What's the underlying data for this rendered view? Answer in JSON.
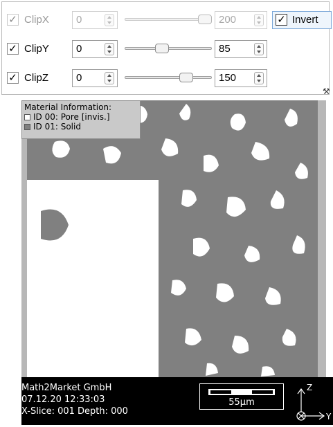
{
  "clip_rows": [
    {
      "label": "ClipX",
      "checked": true,
      "enabled": false,
      "min_value": "0",
      "max_value": "200",
      "slider_fraction": 1.0
    },
    {
      "label": "ClipY",
      "checked": true,
      "enabled": true,
      "min_value": "0",
      "max_value": "85",
      "slider_fraction": 0.43
    },
    {
      "label": "ClipZ",
      "checked": true,
      "enabled": true,
      "min_value": "0",
      "max_value": "150",
      "slider_fraction": 0.75
    }
  ],
  "invert": {
    "label": "Invert",
    "checked": true
  },
  "check_glyph": "✓",
  "legend": {
    "title": "Material Information:",
    "items": [
      {
        "label": "ID 00: Pore [invis.]",
        "color": "#ffffff"
      },
      {
        "label": "ID 01: Solid",
        "color": "#808080"
      }
    ]
  },
  "info": {
    "company": "Math2Market GmbH",
    "timestamp": "07.12.20 12:33:03",
    "slice": "X-Slice: 001 Depth: 000"
  },
  "scale_bar": {
    "label": "55µm"
  },
  "axes": {
    "z": "Z",
    "y": "Y"
  },
  "colors": {
    "solid": "#808080",
    "pore": "#ffffff",
    "background": "#b7b7b7",
    "accent": "#7aa7d8"
  }
}
